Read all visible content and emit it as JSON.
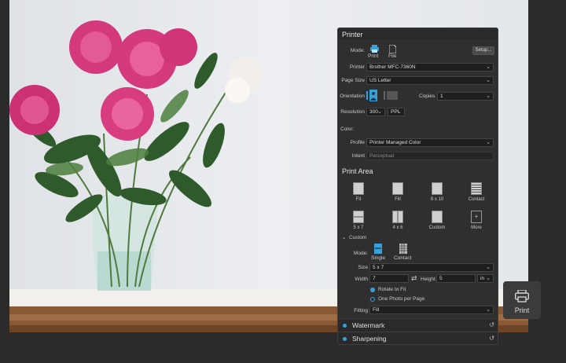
{
  "panel": {
    "title": "Printer",
    "mode": {
      "label": "Mode:",
      "printer": "Print",
      "file": "File",
      "setup": "Setup..."
    },
    "printer": {
      "label": "Printer",
      "value": "Brother MFC-7360N"
    },
    "page_size": {
      "label": "Page Size",
      "value": "US Letter"
    },
    "orientation": {
      "label": "Orientation",
      "copies_label": "Copies",
      "copies_value": "1"
    },
    "resolution": {
      "label": "Resolution",
      "value": "300",
      "unit": "PPI"
    },
    "color": {
      "label": "Color:",
      "profile_label": "Profile",
      "profile_value": "Printer Managed Color",
      "intent_label": "Intent",
      "intent_value": "Perceptual"
    },
    "print_area": {
      "title": "Print Area",
      "tiles": [
        "Fit",
        "Fill",
        "8 x 10",
        "Contact",
        "5 x 7",
        "4 x 6",
        "Custom",
        "More"
      ],
      "custom": {
        "title": "Custom",
        "mode_label": "Mode:",
        "single": "Single",
        "contact": "Contact",
        "size_label": "Size",
        "size_value": "5 x 7",
        "width_label": "Width",
        "width_value": "7",
        "height_label": "Height",
        "height_value": "5",
        "unit": "in",
        "rotate": "Rotate to Fit",
        "one_photo": "One Photo per Page"
      },
      "fitting_label": "Fitting",
      "fitting_value": "Fill"
    },
    "watermark": "Watermark",
    "sharpening": "Sharpening"
  },
  "print_button": "Print",
  "colors": {
    "accent": "#3aa0d8",
    "panel": "#2f2f2f",
    "background": "#2b2b2b"
  }
}
